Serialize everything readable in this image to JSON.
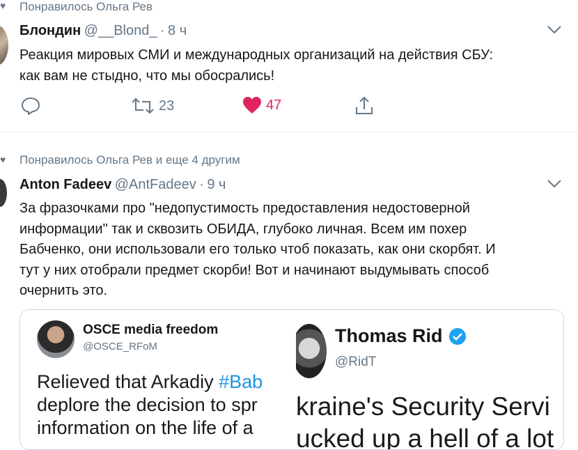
{
  "tweet1": {
    "social_context": "Понравилось Ольга Рев",
    "author_name": "Блондин",
    "author_handle": "@__Blond_",
    "separator": "·",
    "time": "8 ч",
    "line1": "Реакция мировых СМИ и международных организаций на действия СБУ:",
    "line2": "как вам не стыдно, что мы обосрались!",
    "retweets": "23",
    "likes": "47"
  },
  "tweet2": {
    "social_context": "Понравилось Ольга Рев и еще 4 другим",
    "author_name": "Anton Fadeev",
    "author_handle": "@AntFadeev",
    "separator": "·",
    "time": "9 ч",
    "lines": [
      "За фразочками про \"недопустимость предоставления недостоверной",
      "информации\" так и сквозить ОБИДА, глубоко личная. Всем им похер",
      "Бабченко, они использовали его только чтоб показать, как они скорбят. И",
      "тут у них отобрали предмет скорби! Вот и начинают выдумывать способ",
      "очернить это."
    ],
    "embed_left": {
      "title": "OSCE media freedom",
      "handle": "@OSCE_RFoM",
      "line1_prefix": "Relieved that Arkadiy ",
      "line1_hashtag": "#Bab",
      "line2": "deplore the decision to spr",
      "line3": "information on the life of a"
    },
    "embed_right": {
      "name": "Thomas Rid",
      "handle": "@RidT",
      "line1": "kraine's Security Servi",
      "line2": "ucked up a hell of a lot"
    }
  },
  "colors": {
    "like_active": "#e0245e",
    "secondary_text": "#657786",
    "verified": "#1da1f2",
    "hashtag": "#1b95e0"
  }
}
